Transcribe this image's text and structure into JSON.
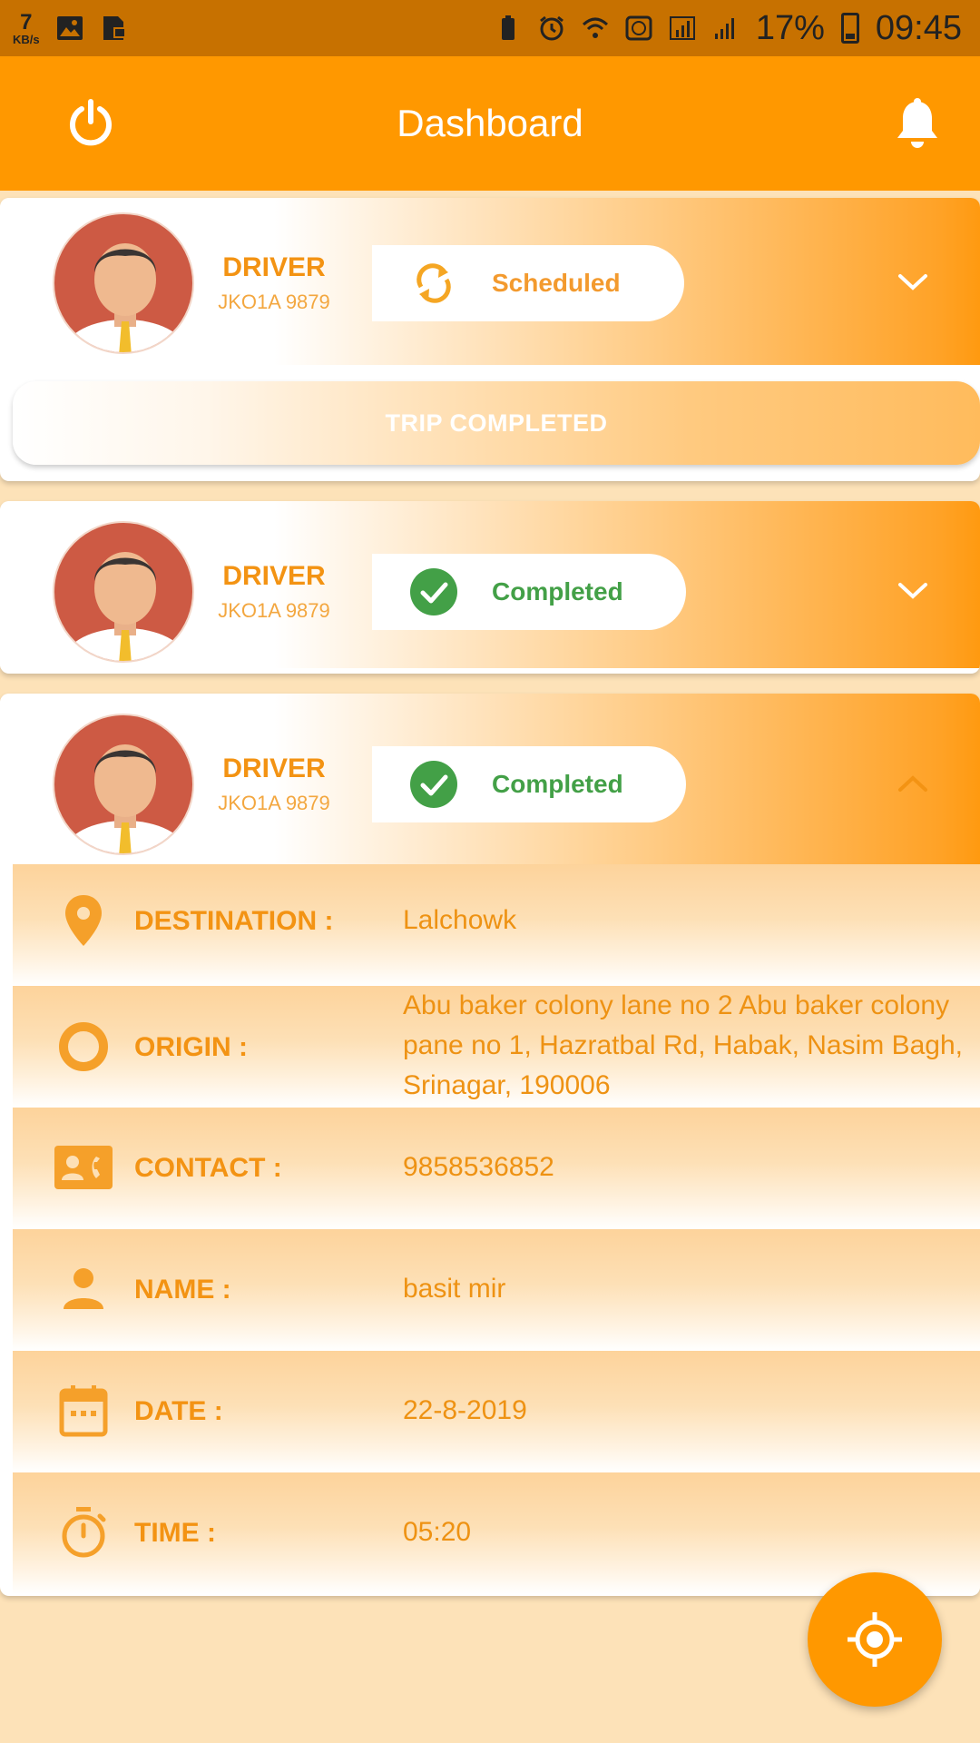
{
  "status_bar": {
    "speed_value": "7",
    "speed_unit": "KB/s",
    "battery_percent": "17%",
    "time": "09:45"
  },
  "app_bar": {
    "title": "Dashboard"
  },
  "trips": [
    {
      "role": "DRIVER",
      "plate": "JKO1A 9879",
      "status": "Scheduled",
      "status_color": "#f39a2e",
      "status_icon": "sync-icon",
      "expanded": false,
      "action_label": "TRIP COMPLETED"
    },
    {
      "role": "DRIVER",
      "plate": "JKO1A 9879",
      "status": "Completed",
      "status_color": "#43a047",
      "status_icon": "check-circle-icon",
      "expanded": false
    },
    {
      "role": "DRIVER",
      "plate": "JKO1A 9879",
      "status": "Completed",
      "status_color": "#43a047",
      "status_icon": "check-circle-icon",
      "expanded": true,
      "details": {
        "destination": {
          "label": "DESTINATION :",
          "value": "Lalchowk",
          "icon": "location-pin-icon"
        },
        "origin": {
          "label": "ORIGIN :",
          "value": "Abu baker colony lane no 2 Abu baker colony pane no 1, Hazratbal Rd, Habak, Nasim Bagh, Srinagar, 190006",
          "icon": "ring-icon"
        },
        "contact": {
          "label": "CONTACT :",
          "value": "9858536852",
          "icon": "contact-card-icon"
        },
        "name": {
          "label": "NAME :",
          "value": "basit mir",
          "icon": "person-icon"
        },
        "date": {
          "label": "DATE :",
          "value": "22-8-2019",
          "icon": "calendar-icon"
        },
        "time": {
          "label": "TIME :",
          "value": "05:20",
          "icon": "stopwatch-icon"
        }
      }
    }
  ],
  "colors": {
    "accent": "#ff9800",
    "status_bar": "#c77100",
    "background": "#fde2b8",
    "label": "#f39313"
  },
  "fab_icon": "my-location-icon"
}
